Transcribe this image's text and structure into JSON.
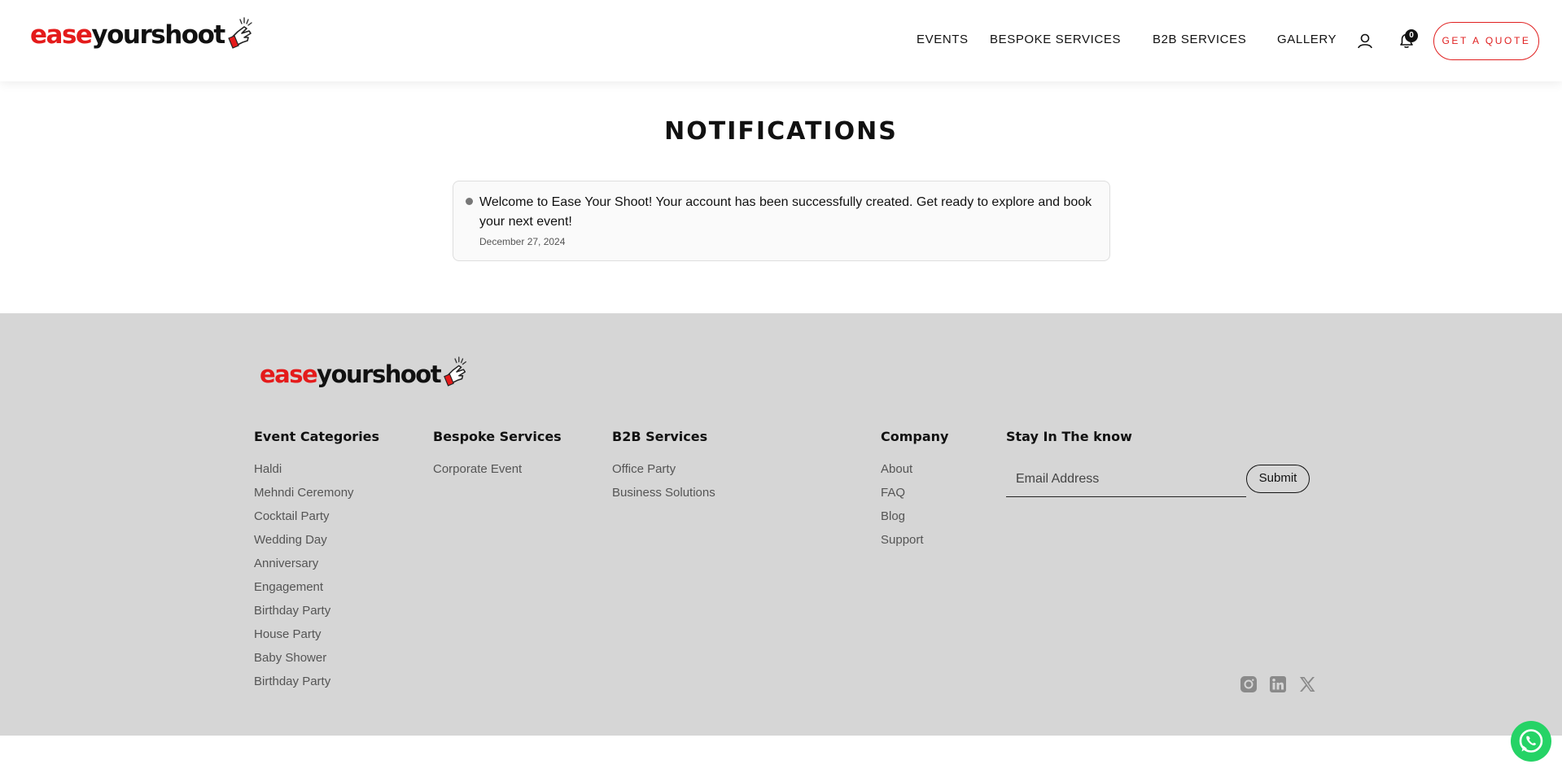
{
  "brand": {
    "logo_part1": "ease",
    "logo_part2": "yourshoot",
    "accent": "#e41b1b"
  },
  "nav": {
    "items": [
      {
        "label": "EVENTS"
      },
      {
        "label": "BESPOKE SERVICES"
      },
      {
        "label": "B2B SERVICES"
      },
      {
        "label": "GALLERY"
      }
    ],
    "user_icon": "user-icon",
    "bell_icon": "bell-icon",
    "notification_count": "0",
    "quote_button": "GET A QUOTE"
  },
  "main": {
    "title": "NOTIFICATIONS",
    "notifications": [
      {
        "message": "Welcome to Ease Your Shoot! Your account has been successfully created. Get ready to explore and book your next event!",
        "date": "December 27, 2024"
      }
    ]
  },
  "footer": {
    "columns": [
      {
        "title": "Event Categories",
        "links": [
          "Haldi",
          "Mehndi Ceremony",
          "Cocktail Party",
          "Wedding Day",
          "Anniversary",
          "Engagement",
          "Birthday Party",
          "House Party",
          "Baby Shower",
          "Birthday Party"
        ]
      },
      {
        "title": "Bespoke Services",
        "links": [
          "Corporate Event"
        ]
      },
      {
        "title": "B2B Services",
        "links": [
          "Office Party",
          "Business Solutions"
        ]
      },
      {
        "title": "Company",
        "links": [
          "About",
          "FAQ",
          "Blog",
          "Support"
        ]
      }
    ],
    "newsletter": {
      "title": "Stay In The know",
      "placeholder": "Email Address",
      "submit_label": "Submit"
    },
    "social_icons": [
      "instagram-icon",
      "linkedin-icon",
      "x-icon"
    ],
    "background": "#d6d6d6"
  },
  "whatsapp_icon": "whatsapp-icon"
}
